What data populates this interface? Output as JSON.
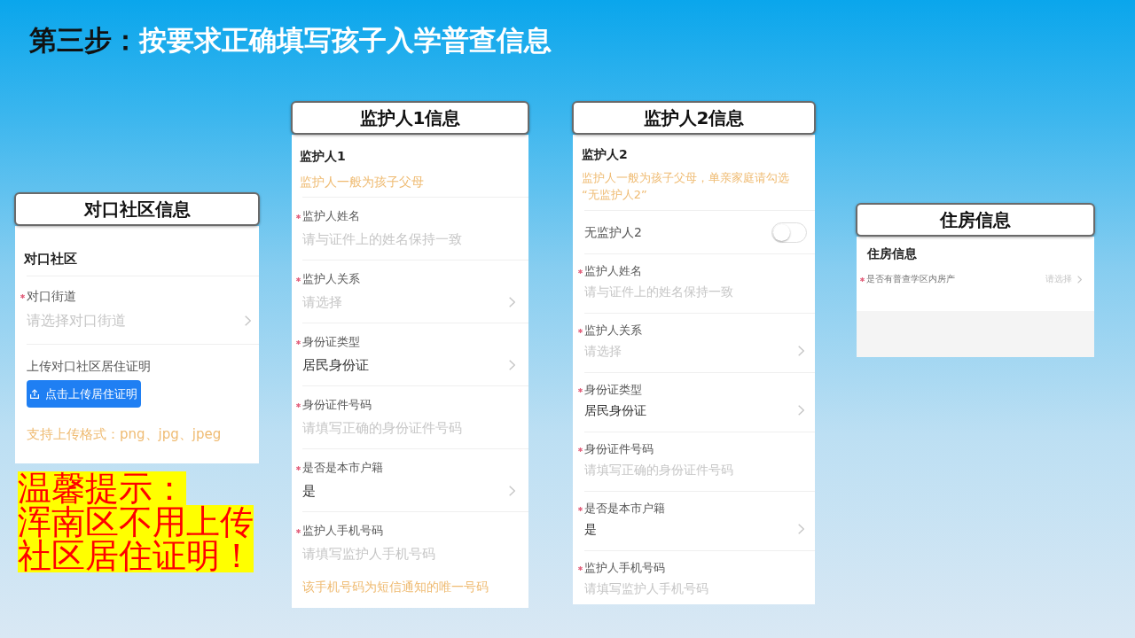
{
  "title": {
    "step": "第三步：",
    "text": "按要求正确填写孩子入学普查信息"
  },
  "panels": [
    {
      "header": "对口社区信息",
      "heading": "对口社区",
      "items": [
        {
          "kind": "field",
          "required": true,
          "label": "对口街道",
          "placeholder": "请选择对口街道",
          "picker": true
        },
        {
          "kind": "upload",
          "required": false,
          "label": "上传对口社区居住证明",
          "button": "点击上传居住证明",
          "hint": "支持上传格式：png、jpg、jpeg"
        }
      ]
    },
    {
      "header": "监护人1信息",
      "heading": "监护人1",
      "note": "监护人一般为孩子父母",
      "items": [
        {
          "kind": "field",
          "required": true,
          "label": "监护人姓名",
          "placeholder": "请与证件上的姓名保持一致",
          "picker": false
        },
        {
          "kind": "field",
          "required": true,
          "label": "监护人关系",
          "placeholder": "请选择",
          "picker": true
        },
        {
          "kind": "field",
          "required": true,
          "label": "身份证类型",
          "value": "居民身份证",
          "picker": true
        },
        {
          "kind": "field",
          "required": true,
          "label": "身份证件号码",
          "placeholder": "请填写正确的身份证件号码",
          "picker": false
        },
        {
          "kind": "field",
          "required": true,
          "label": "是否是本市户籍",
          "value": "是",
          "picker": true
        },
        {
          "kind": "field",
          "required": true,
          "label": "监护人手机号码",
          "placeholder": "请填写监护人手机号码",
          "picker": false,
          "hint": "该手机号码为短信通知的唯一号码"
        }
      ]
    },
    {
      "header": "监护人2信息",
      "heading": "监护人2",
      "note": "监护人一般为孩子父母，单亲家庭请勾选“无监护人2”",
      "items": [
        {
          "kind": "toggle",
          "required": false,
          "label": "无监护人2",
          "on": false
        },
        {
          "kind": "field",
          "required": true,
          "label": "监护人姓名",
          "placeholder": "请与证件上的姓名保持一致",
          "picker": false
        },
        {
          "kind": "field",
          "required": true,
          "label": "监护人关系",
          "placeholder": "请选择",
          "picker": true
        },
        {
          "kind": "field",
          "required": true,
          "label": "身份证类型",
          "value": "居民身份证",
          "picker": true
        },
        {
          "kind": "field",
          "required": true,
          "label": "身份证件号码",
          "placeholder": "请填写正确的身份证件号码",
          "picker": false
        },
        {
          "kind": "field",
          "required": true,
          "label": "是否是本市户籍",
          "value": "是",
          "picker": true
        },
        {
          "kind": "field",
          "required": true,
          "label": "监护人手机号码",
          "placeholder": "请填写监护人手机号码",
          "picker": false
        }
      ]
    },
    {
      "header": "住房信息",
      "heading": "住房信息",
      "items": [
        {
          "kind": "inline",
          "required": true,
          "label": "是否有普查学区内房产",
          "placeholder": "请选择",
          "picker": true
        }
      ]
    }
  ],
  "tip": {
    "lines": [
      "温馨提示：",
      "浑南区不用上传",
      "社区居住证明！"
    ]
  }
}
